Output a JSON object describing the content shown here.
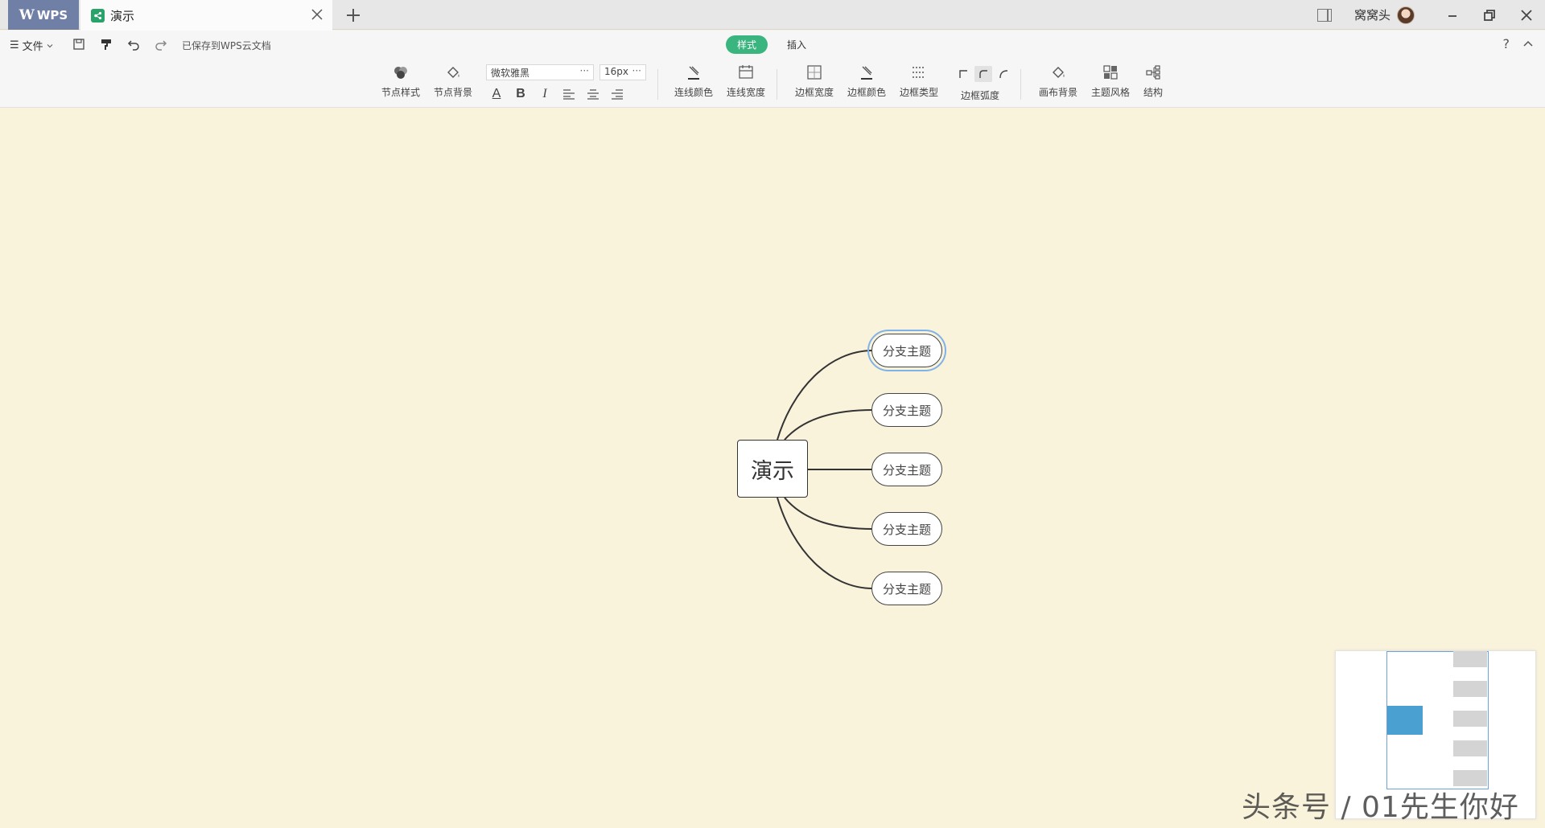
{
  "titlebar": {
    "app_tab": "WPS",
    "doc_tab": "演示",
    "username": "窝窝头"
  },
  "quick": {
    "file_menu": "文件",
    "save_status": "已保存到WPS云文档",
    "tab_style": "样式",
    "tab_insert": "插入",
    "help": "?"
  },
  "ribbon": {
    "node_style": "节点样式",
    "node_bg": "节点背景",
    "font_family": "微软雅黑",
    "font_size": "16px",
    "line_color": "连线颜色",
    "line_width": "连线宽度",
    "border_width": "边框宽度",
    "border_color": "边框颜色",
    "border_type": "边框类型",
    "border_radius": "边框弧度",
    "canvas_bg": "画布背景",
    "theme_style": "主题风格",
    "structure": "结构",
    "format_labels": {
      "font_color": "A",
      "bold": "B",
      "italic": "I"
    }
  },
  "mindmap": {
    "root": "演示",
    "branches": [
      "分支主题",
      "分支主题",
      "分支主题",
      "分支主题",
      "分支主题"
    ],
    "selected_index": 0
  },
  "colors": {
    "canvas_bg": "#faf3dc",
    "accent_green": "#3bb57f",
    "wps_tab": "#6f7fa6",
    "selection": "#7fb2e8",
    "minimap_root": "#4aa0d0"
  },
  "watermark": "头条号 / 01先生你好"
}
